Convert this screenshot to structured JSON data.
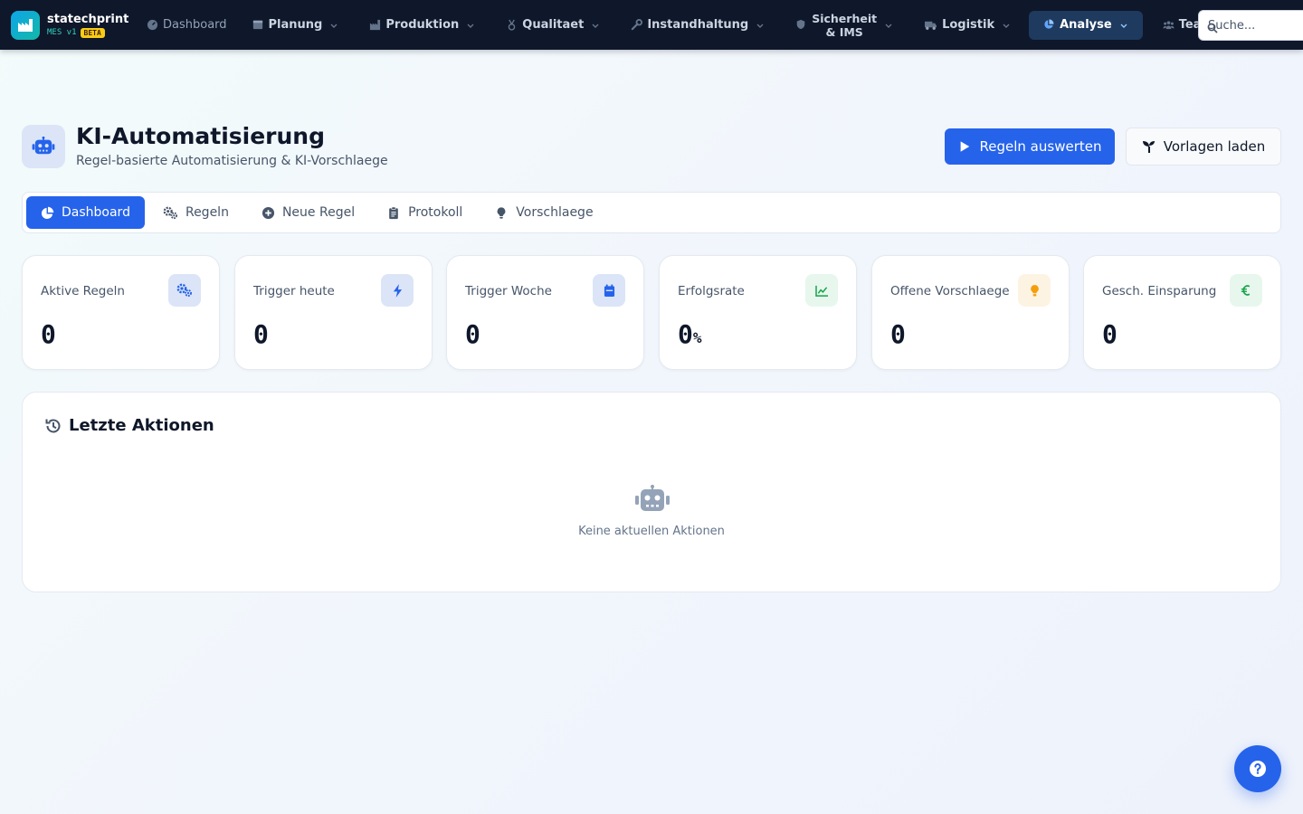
{
  "brand": {
    "name": "statechprint",
    "version": "MES v1",
    "badge": "BETA"
  },
  "nav": {
    "items": [
      {
        "label": "Dashboard",
        "icon": "gauge-icon"
      },
      {
        "label": "Planung",
        "icon": "calendar-icon"
      },
      {
        "label": "Produktion",
        "icon": "factory-icon"
      },
      {
        "label": "Qualitaet",
        "icon": "medal-icon"
      },
      {
        "label": "Instandhaltung",
        "icon": "wrench-icon"
      },
      {
        "label_line1": "Sicherheit",
        "label_line2": "& IMS",
        "icon": "shield-icon"
      },
      {
        "label": "Logistik",
        "icon": "truck-icon"
      },
      {
        "label": "Analyse",
        "icon": "pie-chart-icon",
        "active": true
      },
      {
        "label": "Team",
        "icon": "users-icon"
      }
    ],
    "search_placeholder": "Suche..."
  },
  "header": {
    "title": "KI-Automatisierung",
    "subtitle": "Regel-basierte Automatisierung & KI-Vorschlaege",
    "primary_button": "Regeln auswerten",
    "secondary_button": "Vorlagen laden"
  },
  "tabs": [
    {
      "label": "Dashboard",
      "icon": "pie-chart-icon",
      "active": true
    },
    {
      "label": "Regeln",
      "icon": "gears-icon"
    },
    {
      "label": "Neue Regel",
      "icon": "plus-circle-icon"
    },
    {
      "label": "Protokoll",
      "icon": "clipboard-icon"
    },
    {
      "label": "Vorschlaege",
      "icon": "lightbulb-icon"
    }
  ],
  "stats": [
    {
      "label": "Aktive Regeln",
      "value": "0",
      "unit": "",
      "icon": "gears-icon",
      "color": "#2563eb"
    },
    {
      "label": "Trigger heute",
      "value": "0",
      "unit": "",
      "icon": "bolt-icon",
      "color": "#2563eb"
    },
    {
      "label": "Trigger Woche",
      "value": "0",
      "unit": "",
      "icon": "calendar-icon",
      "color": "#2563eb"
    },
    {
      "label": "Erfolgsrate",
      "value": "0",
      "unit": "%",
      "icon": "line-chart-icon",
      "color": "#16a34a"
    },
    {
      "label": "Offene Vorschlaege",
      "value": "0",
      "unit": "",
      "icon": "lightbulb-icon",
      "color": "#f59e0b"
    },
    {
      "label": "Gesch. Einsparung",
      "value": "0",
      "unit": "",
      "icon": "euro-icon",
      "color": "#16a34a"
    }
  ],
  "recent": {
    "title": "Letzte Aktionen",
    "empty_text": "Keine aktuellen Aktionen"
  },
  "colors": {
    "primary": "#2563eb",
    "nav_bg": "#0f172a",
    "brand_teal": "#14b8a6",
    "badge": "#facc15"
  }
}
